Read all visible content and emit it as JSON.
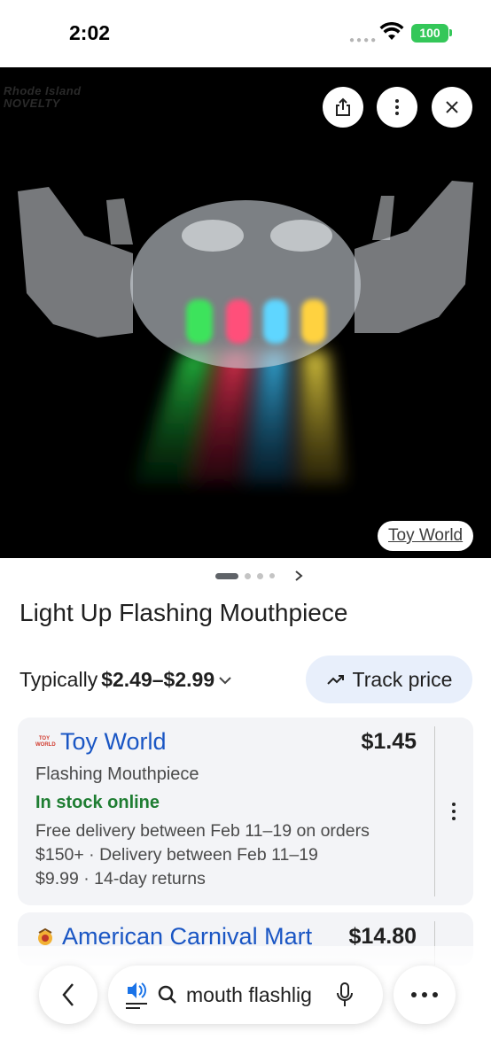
{
  "status_bar": {
    "time": "2:02",
    "battery": "100",
    "signal_icon": "cellular-dots-icon",
    "wifi_icon": "wifi-icon"
  },
  "hero": {
    "brand_watermark_line1": "Rhode Island",
    "brand_watermark_line2": "NOVELTY",
    "share_icon": "share-icon",
    "more_icon": "more-vert-icon",
    "close_icon": "close-icon",
    "source_label": "Toy World"
  },
  "carousel": {
    "active_index": 0,
    "count": 4
  },
  "product": {
    "title": "Light Up Flashing Mouthpiece",
    "price_prefix": "Typically ",
    "price_range": "$2.49–$2.99",
    "track_label": "Track price"
  },
  "offers": [
    {
      "store": "Toy World",
      "logo_text": "TOY WORLD",
      "price": "$1.45",
      "item": "Flashing Mouthpiece",
      "stock": "In stock online",
      "delivery_line1": "Free delivery between Feb 11–19 on orders",
      "delivery_line2": "$150+ · Delivery between Feb 11–19",
      "delivery_line3": "$9.99 · 14-day returns"
    },
    {
      "store": "American Carnival Mart",
      "price": "$14.80"
    }
  ],
  "bottom_bar": {
    "back_icon": "back-arrow-icon",
    "audio_icon": "read-aloud-icon",
    "search_icon": "search-icon",
    "query": "mouth flashlig",
    "mic_icon": "mic-icon",
    "more_icon": "more-horiz-icon"
  },
  "colors": {
    "accent": "#1a56c4",
    "in_stock": "#1e7d32",
    "track_bg": "#e8effb",
    "battery": "#34c759"
  }
}
